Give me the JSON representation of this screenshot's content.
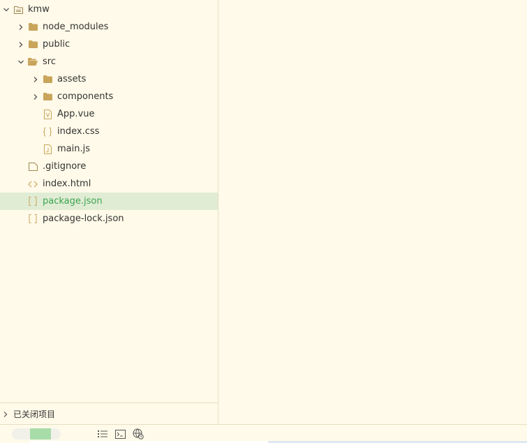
{
  "sidebar": {
    "tree": [
      {
        "label": "kmw",
        "type": "root",
        "expanded": true,
        "level": 0,
        "icon": "project-folder-icon"
      },
      {
        "label": "node_modules",
        "type": "folder",
        "expanded": false,
        "level": 1,
        "icon": "folder-icon"
      },
      {
        "label": "public",
        "type": "folder",
        "expanded": false,
        "level": 1,
        "icon": "folder-icon"
      },
      {
        "label": "src",
        "type": "folder",
        "expanded": true,
        "level": 1,
        "icon": "folder-open-icon"
      },
      {
        "label": "assets",
        "type": "folder",
        "expanded": false,
        "level": 2,
        "icon": "folder-icon"
      },
      {
        "label": "components",
        "type": "folder",
        "expanded": false,
        "level": 2,
        "icon": "folder-icon"
      },
      {
        "label": "App.vue",
        "type": "file",
        "level": 2,
        "icon": "vue-file-icon"
      },
      {
        "label": "index.css",
        "type": "file",
        "level": 2,
        "icon": "css-file-icon"
      },
      {
        "label": "main.js",
        "type": "file",
        "level": 2,
        "icon": "js-file-icon"
      },
      {
        "label": ".gitignore",
        "type": "file",
        "level": 1,
        "icon": "generic-file-icon"
      },
      {
        "label": "index.html",
        "type": "file",
        "level": 1,
        "icon": "html-file-icon"
      },
      {
        "label": "package.json",
        "type": "file",
        "level": 1,
        "icon": "json-file-icon",
        "selected": true
      },
      {
        "label": "package-lock.json",
        "type": "file",
        "level": 1,
        "icon": "json-file-icon"
      }
    ],
    "closed_projects_label": "已关闭项目"
  },
  "statusbar": {
    "icons": [
      "list-icon",
      "terminal-icon",
      "browser-preview-icon"
    ]
  },
  "colors": {
    "background": "#fffae9",
    "selected_row": "#e0ecd4",
    "selected_text": "#3ca550",
    "folder": "#c9a55c"
  }
}
